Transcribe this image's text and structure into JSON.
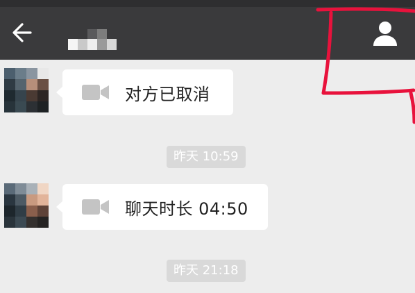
{
  "header": {
    "back_icon": "arrow-left-icon",
    "title_obscured": true,
    "profile_icon": "person-icon"
  },
  "messages": [
    {
      "type": "video-call",
      "icon": "video-camera-icon",
      "text": "对方已取消"
    },
    {
      "type": "timestamp",
      "text": "昨天 10:59"
    },
    {
      "type": "video-call",
      "icon": "video-camera-icon",
      "text": "聊天时长 04:50"
    },
    {
      "type": "timestamp",
      "text": "昨天 21:18"
    }
  ],
  "colors": {
    "topbar": "#3a3a3c",
    "chat_background": "#ededed",
    "bubble": "#ffffff",
    "timestamp_badge": "#d9d9d9",
    "annotation_red": "#e8123c"
  }
}
